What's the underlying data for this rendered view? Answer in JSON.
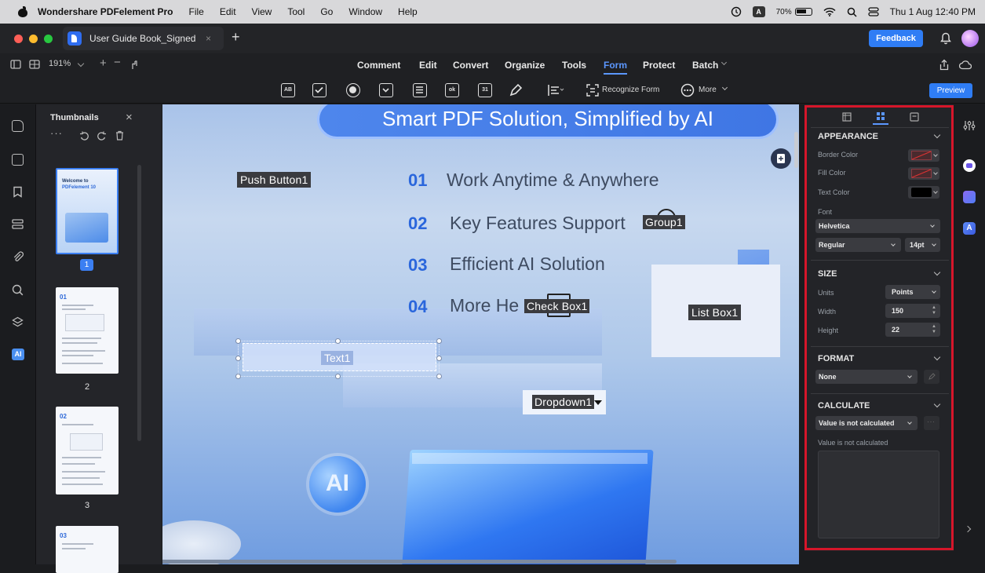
{
  "menubar": {
    "app_name": "Wondershare PDFelement Pro",
    "items": [
      "File",
      "Edit",
      "View",
      "Tool",
      "Go",
      "Window",
      "Help"
    ],
    "input_badge": "A",
    "battery": "70%",
    "clock": "Thu 1 Aug  12:40 PM"
  },
  "titlebar": {
    "tab_title": "User Guide Book_Signed",
    "feedback_label": "Feedback"
  },
  "toolbar": {
    "zoom": "191%",
    "menu": [
      "Comment",
      "Edit",
      "Convert",
      "Organize",
      "Tools",
      "Form",
      "Protect",
      "Batch"
    ],
    "active_menu": "Form",
    "recognize_label": "Recognize Form",
    "more_label": "More",
    "preview_label": "Preview",
    "form_icons": [
      "AB",
      "ok",
      "31"
    ]
  },
  "thumbnails": {
    "title": "Thumbnails",
    "pages": [
      "1",
      "2",
      "3"
    ],
    "page1_heading": "Welcome to",
    "page1_brand": "PDFelement 10",
    "page2_num": "01",
    "page3_num": "02",
    "page4_num": "03"
  },
  "canvas": {
    "headline": "Smart PDF Solution, Simplified by AI",
    "features": [
      {
        "num": "01",
        "text": "Work Anytime & Anywhere"
      },
      {
        "num": "02",
        "text": "Key Features Support"
      },
      {
        "num": "03",
        "text": "Efficient AI Solution"
      },
      {
        "num": "04",
        "text": "More He"
      }
    ],
    "fields": {
      "push_button": "Push Button1",
      "group": "Group1",
      "check_box": "Check Box1",
      "list_box": "List Box1",
      "text": "Text1",
      "dropdown": "Dropdown1"
    },
    "ai_badge": "AI"
  },
  "props": {
    "appearance": {
      "title": "APPEARANCE",
      "border_color_label": "Border Color",
      "fill_color_label": "Fill Color",
      "text_color_label": "Text Color",
      "font_label": "Font",
      "font_value": "Helvetica",
      "style_value": "Regular",
      "size_value": "14pt",
      "text_color": "#000000"
    },
    "size": {
      "title": "SIZE",
      "units_label": "Units",
      "units_value": "Points",
      "width_label": "Width",
      "width_value": "150",
      "height_label": "Height",
      "height_value": "22"
    },
    "format": {
      "title": "FORMAT",
      "value": "None"
    },
    "calculate": {
      "title": "CALCULATE",
      "value": "Value is not calculated",
      "note": "Value is not calculated"
    }
  },
  "left_rail": {
    "ai_label": "AI"
  }
}
